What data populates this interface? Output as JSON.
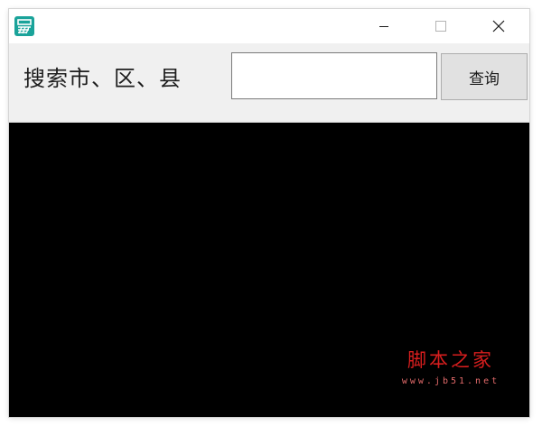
{
  "titlebar": {
    "icon": "app-logo-icon",
    "controls": {
      "minimize": "minimize-icon",
      "maximize": "maximize-icon",
      "close": "close-icon"
    }
  },
  "search": {
    "label": "搜索市、区、县",
    "input_value": "",
    "button_label": "查询"
  },
  "content": {
    "background": "#000000"
  },
  "watermark": {
    "title": "脚本之家",
    "url": "www.jb51.net"
  },
  "colors": {
    "app_icon": "#1aa39a",
    "watermark": "#d81e1e",
    "panel": "#f0f0f0"
  }
}
